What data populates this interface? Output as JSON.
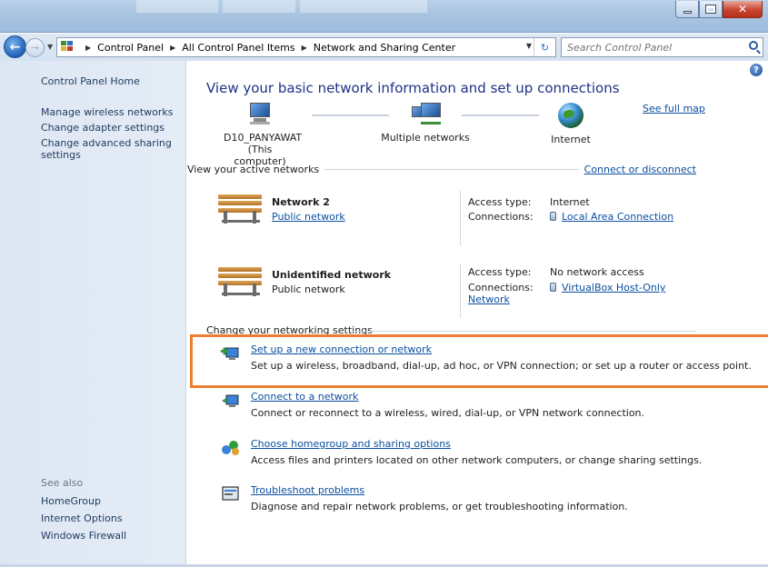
{
  "window": {
    "controls": {
      "minimize": "minimize",
      "maximize": "maximize",
      "close": "close"
    }
  },
  "address": {
    "crumbs": [
      "Control Panel",
      "All Control Panel Items",
      "Network and Sharing Center"
    ],
    "search_placeholder": "Search Control Panel"
  },
  "sidebar": {
    "home": "Control Panel Home",
    "tasks": [
      "Manage wireless networks",
      "Change adapter settings",
      "Change advanced sharing settings"
    ],
    "see_also_title": "See also",
    "see_also": [
      "HomeGroup",
      "Internet Options",
      "Windows Firewall"
    ]
  },
  "main": {
    "heading": "View your basic network information and set up connections",
    "see_full_map": "See full map",
    "map": {
      "computer_name": "D10_PANYAWAT",
      "computer_sub": "(This computer)",
      "middle": "Multiple networks",
      "internet": "Internet"
    },
    "active_title": "View your active networks",
    "connect_or_disconnect": "Connect or disconnect",
    "networks": [
      {
        "name": "Network  2",
        "type": "Public network",
        "access_label": "Access type:",
        "access": "Internet",
        "conn_label": "Connections:",
        "connection": "Local Area Connection"
      },
      {
        "name": "Unidentified network",
        "type": "Public network",
        "access_label": "Access type:",
        "access": "No network access",
        "conn_label": "Connections:",
        "connection": "VirtualBox Host-Only Network"
      }
    ],
    "change_title": "Change your networking settings",
    "tasks": [
      {
        "link": "Set up a new connection or network",
        "desc": "Set up a wireless, broadband, dial-up, ad hoc, or VPN connection; or set up a router or access point."
      },
      {
        "link": "Connect to a network",
        "desc": "Connect or reconnect to a wireless, wired, dial-up, or VPN network connection."
      },
      {
        "link": "Choose homegroup and sharing options",
        "desc": "Access files and printers located on other network computers, or change sharing settings."
      },
      {
        "link": "Troubleshoot problems",
        "desc": "Diagnose and repair network problems, or get troubleshooting information."
      }
    ]
  },
  "colors": {
    "link": "#0b4fa0",
    "heading": "#1e3287",
    "highlight": "#ed7d31"
  }
}
